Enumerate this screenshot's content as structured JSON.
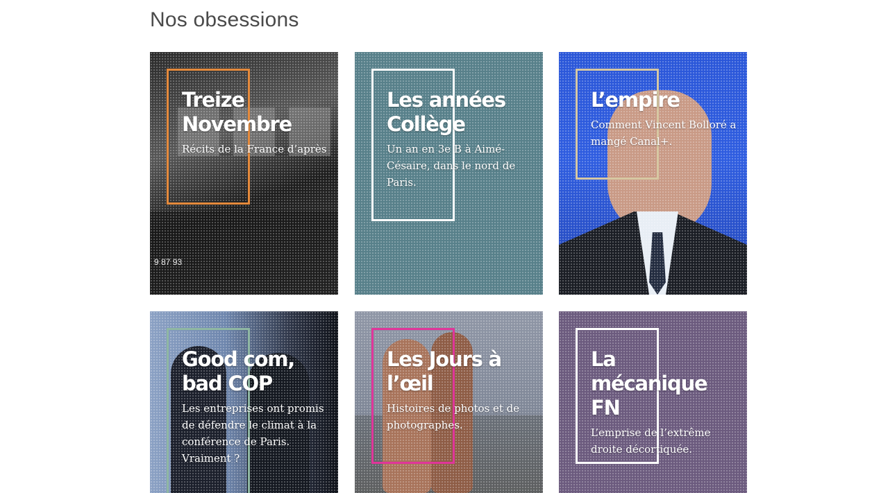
{
  "section": {
    "title": "Nos obsessions"
  },
  "cards": [
    {
      "title": "Treize Novembre",
      "subtitle": "Récits de la France d’après",
      "accent": "#e58a3c"
    },
    {
      "title": "Les années Collège",
      "subtitle": "Un an en 3e B à Aimé-Césaire, dans le nord de Paris.",
      "accent": "#ffffff"
    },
    {
      "title": "L’empire",
      "subtitle": "Comment Vincent Bolloré a mangé Canal+.",
      "accent": "#d7c8a3"
    },
    {
      "title": "Good com, bad COP",
      "subtitle": "Les entreprises ont promis de défendre le climat à la conférence de Paris. Vraiment ?",
      "accent": "#8fb7a3"
    },
    {
      "title": "Les Jours à l’œil",
      "subtitle": "Histoires de photos et de photographes.",
      "accent": "#e0369a"
    },
    {
      "title": "La mécanique FN",
      "subtitle": "L’emprise de l’extrême droite décortiquée.",
      "accent": "#ffffff"
    }
  ],
  "extra_text": {
    "phone_fragment": "9 87 93"
  }
}
